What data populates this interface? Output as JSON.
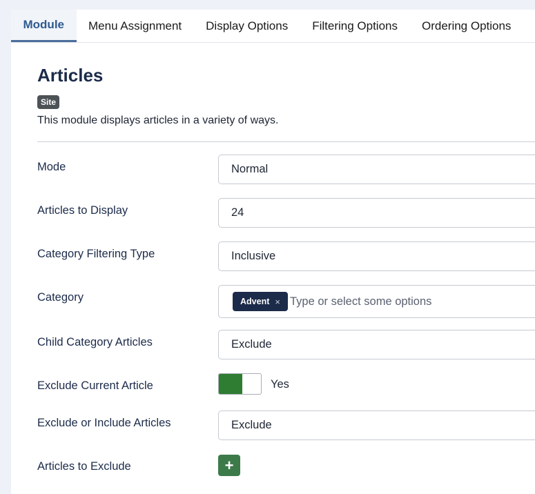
{
  "tabs": [
    {
      "label": "Module",
      "active": true
    },
    {
      "label": "Menu Assignment"
    },
    {
      "label": "Display Options"
    },
    {
      "label": "Filtering Options"
    },
    {
      "label": "Ordering Options"
    }
  ],
  "header": {
    "title": "Articles",
    "badge": "Site",
    "description": "This module displays articles in a variety of ways."
  },
  "fields": {
    "mode": {
      "label": "Mode",
      "value": "Normal"
    },
    "articles_to_display": {
      "label": "Articles to Display",
      "value": "24"
    },
    "category_filtering_type": {
      "label": "Category Filtering Type",
      "value": "Inclusive"
    },
    "category": {
      "label": "Category",
      "tags": [
        {
          "label": "Advent",
          "remove": "×"
        }
      ],
      "placeholder": "Type or select some options"
    },
    "child_category_articles": {
      "label": "Child Category Articles",
      "value": "Exclude"
    },
    "exclude_current_article": {
      "label": "Exclude Current Article",
      "state": "Yes"
    },
    "exclude_or_include_articles": {
      "label": "Exclude or Include Articles",
      "value": "Exclude"
    },
    "articles_to_exclude": {
      "label": "Articles to Exclude",
      "add_icon": "plus-icon",
      "add_glyph": "+"
    }
  },
  "colors": {
    "accent": "#1c2b4a",
    "toggle_on": "#2e7d32",
    "add_button": "#3d7a4a",
    "badge": "#4d5257"
  }
}
